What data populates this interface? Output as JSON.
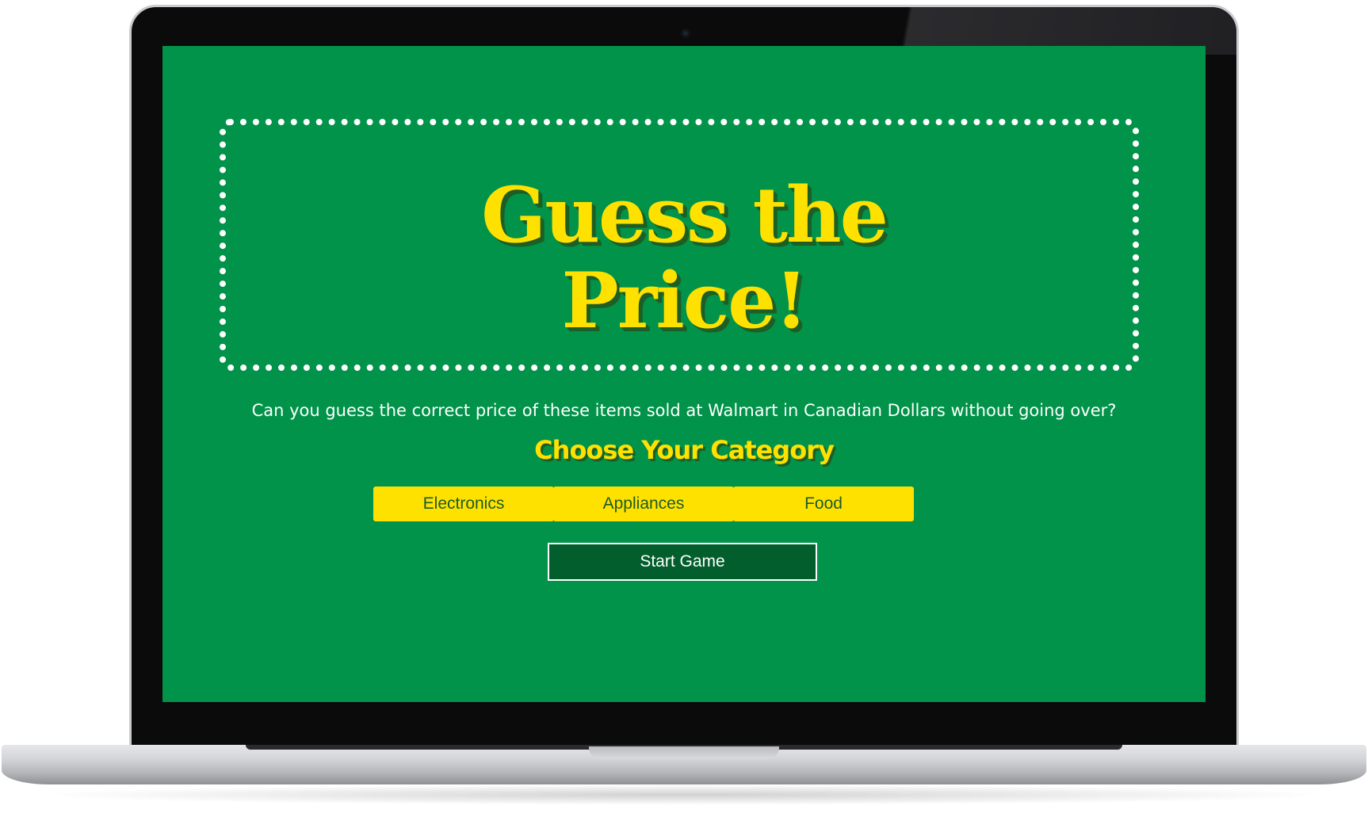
{
  "game": {
    "title_line1": "Guess the",
    "title_line2": "Price!",
    "subtitle": "Can you guess the correct price of these items sold at Walmart in Canadian Dollars without going over?",
    "category_heading": "Choose Your Category",
    "categories": [
      {
        "label": "Electronics"
      },
      {
        "label": "Appliances"
      },
      {
        "label": "Food"
      }
    ],
    "start_label": "Start Game"
  },
  "colors": {
    "background": "#009349",
    "accent_yellow": "#ffe100",
    "dark_green": "#035e2d",
    "text_shadow": "#1d5e24"
  }
}
